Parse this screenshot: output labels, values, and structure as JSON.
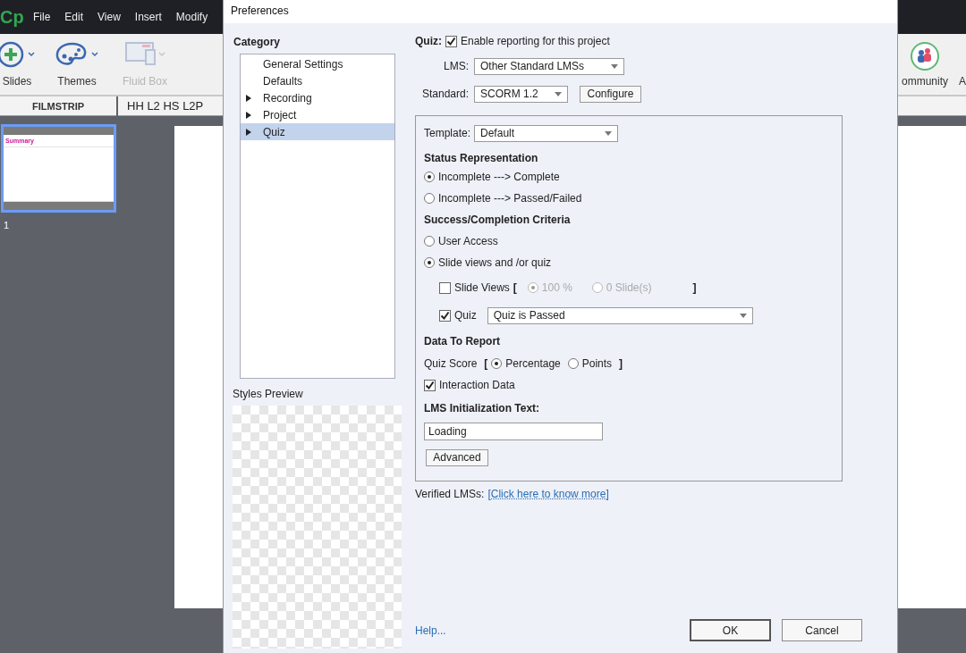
{
  "app": {
    "logo": "Cp",
    "menu": [
      "File",
      "Edit",
      "View",
      "Insert",
      "Modify"
    ],
    "toolbar_left": [
      {
        "kind": "slides",
        "label": "Slides",
        "disabled": false
      },
      {
        "kind": "themes",
        "label": "Themes",
        "disabled": false
      },
      {
        "kind": "fluid",
        "label": "Fluid Box",
        "disabled": true
      }
    ],
    "toolbar_right": [
      {
        "kind": "community",
        "label": "ommunity",
        "disabled": false
      },
      {
        "kind": "cut",
        "label": "A",
        "disabled": false
      }
    ],
    "filmstrip": {
      "title": "FILMSTRIP",
      "slides": [
        {
          "number": "1",
          "title": "Summary",
          "selected": true
        }
      ]
    },
    "document_tab": "HH L2 HS L2P"
  },
  "dialog": {
    "title": "Preferences",
    "category": {
      "title": "Category",
      "items": [
        {
          "label": "General Settings",
          "expandable": false,
          "selected": false
        },
        {
          "label": "Defaults",
          "expandable": false,
          "selected": false
        },
        {
          "label": "Recording",
          "expandable": true,
          "selected": false
        },
        {
          "label": "Project",
          "expandable": true,
          "selected": false
        },
        {
          "label": "Quiz",
          "expandable": true,
          "selected": true
        }
      ]
    },
    "styles_preview": "Styles Preview",
    "quiz_label": "Quiz:",
    "enable_reporting": {
      "label": "Enable reporting for this project",
      "checked": true
    },
    "lms": {
      "label": "LMS:",
      "value": "Other Standard LMSs"
    },
    "standard": {
      "label": "Standard:",
      "value": "SCORM 1.2"
    },
    "configure": "Configure",
    "template": {
      "label": "Template:",
      "value": "Default"
    },
    "status_title": "Status Representation",
    "status_options": [
      {
        "label": "Incomplete ---> Complete",
        "selected": true
      },
      {
        "label": "Incomplete ---> Passed/Failed",
        "selected": false
      }
    ],
    "criteria_title": "Success/Completion Criteria",
    "criteria_options": [
      {
        "label": "User Access",
        "selected": false
      },
      {
        "label": "Slide views and /or quiz",
        "selected": true
      }
    ],
    "slide_views": {
      "label": "Slide Views",
      "checked": false,
      "open_bracket": "[",
      "close_bracket": "]",
      "options": [
        {
          "label": "100 %",
          "selected": true,
          "disabled": true
        },
        {
          "label": "0 Slide(s)",
          "selected": false,
          "disabled": true
        }
      ]
    },
    "quiz": {
      "label": "Quiz",
      "checked": true,
      "value": "Quiz is Passed"
    },
    "data_title": "Data To Report",
    "quiz_score": {
      "label": "Quiz Score",
      "open_bracket": "[",
      "close_bracket": "]",
      "options": [
        {
          "label": "Percentage",
          "selected": true
        },
        {
          "label": "Points",
          "selected": false
        }
      ]
    },
    "interaction_data": {
      "label": "Interaction Data",
      "checked": true
    },
    "init_text_title": "LMS Initialization Text:",
    "init_text_value": "Loading",
    "advanced": "Advanced",
    "verified_label": "Verified LMSs:",
    "verified_link": "[Click here to know more]",
    "help": "Help...",
    "ok": "OK",
    "cancel": "Cancel"
  }
}
